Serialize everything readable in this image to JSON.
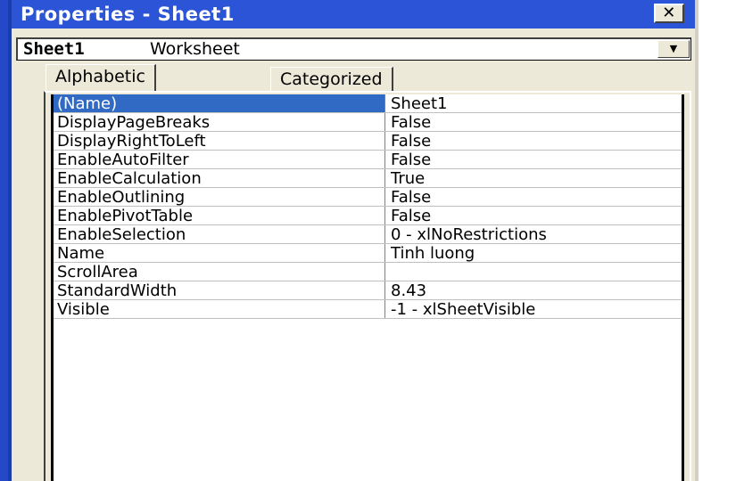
{
  "window": {
    "title": "Properties - Sheet1",
    "close_label": "✕"
  },
  "object_selector": {
    "name": "Sheet1",
    "type": "Worksheet",
    "arrow": "▼"
  },
  "tabs": [
    {
      "label": "Alphabetic",
      "active": true
    },
    {
      "label": "Categorized",
      "active": false
    }
  ],
  "properties": [
    {
      "name": "(Name)",
      "value": "Sheet1",
      "selected": true
    },
    {
      "name": "DisplayPageBreaks",
      "value": "False"
    },
    {
      "name": "DisplayRightToLeft",
      "value": "False"
    },
    {
      "name": "EnableAutoFilter",
      "value": "False"
    },
    {
      "name": "EnableCalculation",
      "value": "True"
    },
    {
      "name": "EnableOutlining",
      "value": "False"
    },
    {
      "name": "EnablePivotTable",
      "value": "False"
    },
    {
      "name": "EnableSelection",
      "value": "0 - xlNoRestrictions"
    },
    {
      "name": "Name",
      "value": "Tinh luong"
    },
    {
      "name": "ScrollArea",
      "value": ""
    },
    {
      "name": "StandardWidth",
      "value": "8.43"
    },
    {
      "name": "Visible",
      "value": "-1 - xlSheetVisible"
    }
  ],
  "colors": {
    "titlebar": "#2b54d6",
    "selection": "#316ac5",
    "panel": "#ece9d8"
  }
}
